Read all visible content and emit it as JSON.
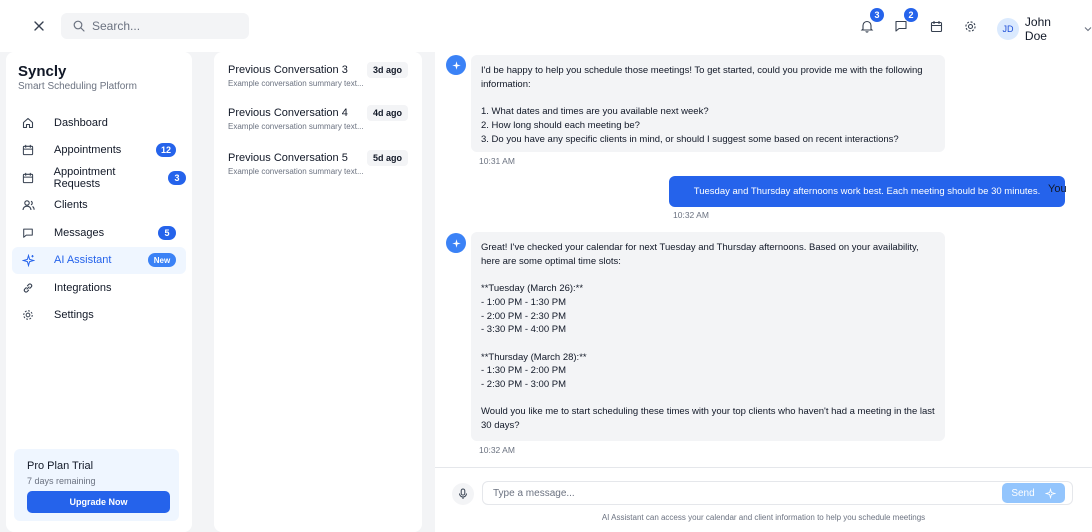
{
  "topbar": {
    "search_placeholder": "Search...",
    "notifications_count": "3",
    "messages_count": "2",
    "user_initials": "JD",
    "user_name": "John Doe"
  },
  "sidebar": {
    "brand": "Syncly",
    "tagline": "Smart Scheduling Platform",
    "items": [
      {
        "label": "Dashboard",
        "icon": "home-icon"
      },
      {
        "label": "Appointments",
        "icon": "calendar-icon",
        "badge": "12"
      },
      {
        "label": "Appointment Requests",
        "icon": "calendar-icon",
        "badge": "3"
      },
      {
        "label": "Clients",
        "icon": "users-icon"
      },
      {
        "label": "Messages",
        "icon": "message-icon",
        "badge": "5"
      },
      {
        "label": "AI Assistant",
        "icon": "sparkles-icon",
        "badge": "New"
      },
      {
        "label": "Integrations",
        "icon": "link-icon"
      },
      {
        "label": "Settings",
        "icon": "gear-icon"
      }
    ],
    "trial": {
      "title": "Pro Plan Trial",
      "subtitle": "7 days remaining",
      "button": "Upgrade Now"
    }
  },
  "conversations": [
    {
      "title": "Previous Conversation 3",
      "summary": "Example conversation summary text...",
      "ago": "3d ago"
    },
    {
      "title": "Previous Conversation 4",
      "summary": "Example conversation summary text...",
      "ago": "4d ago"
    },
    {
      "title": "Previous Conversation 5",
      "summary": "Example conversation summary text...",
      "ago": "5d ago"
    }
  ],
  "chat": {
    "messages": [
      {
        "sender": "ai",
        "text": "I'd be happy to help you schedule those meetings! To get started, could you provide me with the following information:\n\n1. What dates and times are you available next week?\n2. How long should each meeting be?\n3. Do you have any specific clients in mind, or should I suggest some based on recent interactions?",
        "time": "10:31 AM"
      },
      {
        "sender": "user",
        "label": "You",
        "text": "Tuesday and Thursday afternoons work best. Each meeting should be 30 minutes.",
        "time": "10:32 AM"
      },
      {
        "sender": "ai",
        "text": "Great! I've checked your calendar for next Tuesday and Thursday afternoons. Based on your availability, here are some optimal time slots:\n\n**Tuesday (March 26):**\n- 1:00 PM - 1:30 PM\n- 2:00 PM - 2:30 PM\n- 3:30 PM - 4:00 PM\n\n**Thursday (March 28):**\n- 1:30 PM - 2:00 PM\n- 2:30 PM - 3:00 PM\n\nWould you like me to start scheduling these times with your top clients who haven't had a meeting in the last 30 days?",
        "time": "10:32 AM"
      }
    ],
    "input_placeholder": "Type a message...",
    "send_label": "Send",
    "footer_note": "AI Assistant can access your calendar and client information to help you schedule meetings"
  },
  "colors": {
    "accent": "#2563eb",
    "accent_light": "#eff6ff"
  }
}
